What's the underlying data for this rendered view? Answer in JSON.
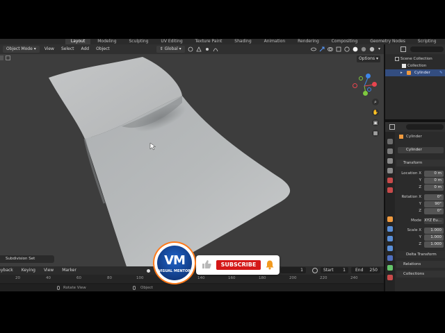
{
  "workspace_tabs": [
    "Layout",
    "Modeling",
    "Sculpting",
    "UV Editing",
    "Texture Paint",
    "Shading",
    "Animation",
    "Rendering",
    "Compositing",
    "Geometry Nodes",
    "Scripting"
  ],
  "viewport_header": {
    "mode": "Object Mode",
    "menus": [
      "View",
      "Select",
      "Add",
      "Object"
    ],
    "orientation": "Global",
    "options": "Options"
  },
  "viewport": {
    "operator_panel": "Subdivision Set",
    "gizmo": {
      "x_color": "#e8454f",
      "y_color": "#7ec93f",
      "z_color": "#3e86e8"
    }
  },
  "timeline": {
    "menus": [
      "Playback",
      "Keying",
      "View",
      "Marker"
    ],
    "current_frame": "1",
    "start_label": "Start",
    "start": "1",
    "end_label": "End",
    "end": "250",
    "ruler": [
      "20",
      "40",
      "60",
      "80",
      "100",
      "120",
      "140",
      "160",
      "180",
      "200",
      "220",
      "240"
    ]
  },
  "status_bar": {
    "left": "Rotate View",
    "right": "Object"
  },
  "outliner": {
    "rows": [
      {
        "label": "Scene Collection",
        "indent": 0
      },
      {
        "label": "Collection",
        "indent": 1
      },
      {
        "label": "Cylinder",
        "indent": 2,
        "selected": true
      }
    ]
  },
  "properties": {
    "object_name": "Cylinder",
    "data_name": "Cylinder",
    "transform_label": "Transform",
    "location": {
      "label": "Location X",
      "y_label": "Y",
      "z_label": "Z",
      "x": "0 m",
      "y": "0 m",
      "z": "0 m"
    },
    "rotation": {
      "label": "Rotation X",
      "y_label": "Y",
      "z_label": "Z",
      "x": "0°",
      "y": "90°",
      "z": "0°"
    },
    "mode_label": "Mode",
    "mode_value": "XYZ Eu...",
    "scale": {
      "label": "Scale X",
      "y_label": "Y",
      "z_label": "Z",
      "x": "1.000",
      "y": "1.000",
      "z": "1.000"
    },
    "delta_transform": "Delta Transform",
    "relations": "Relations",
    "collections": "Collections"
  },
  "overlay": {
    "logo_initials": "VM",
    "logo_caption": "VISUAL MENTOR",
    "subscribe": "SUBSCRIBE",
    "subscribe_color": "#d41818",
    "ring_color": "#ff7a1a"
  }
}
